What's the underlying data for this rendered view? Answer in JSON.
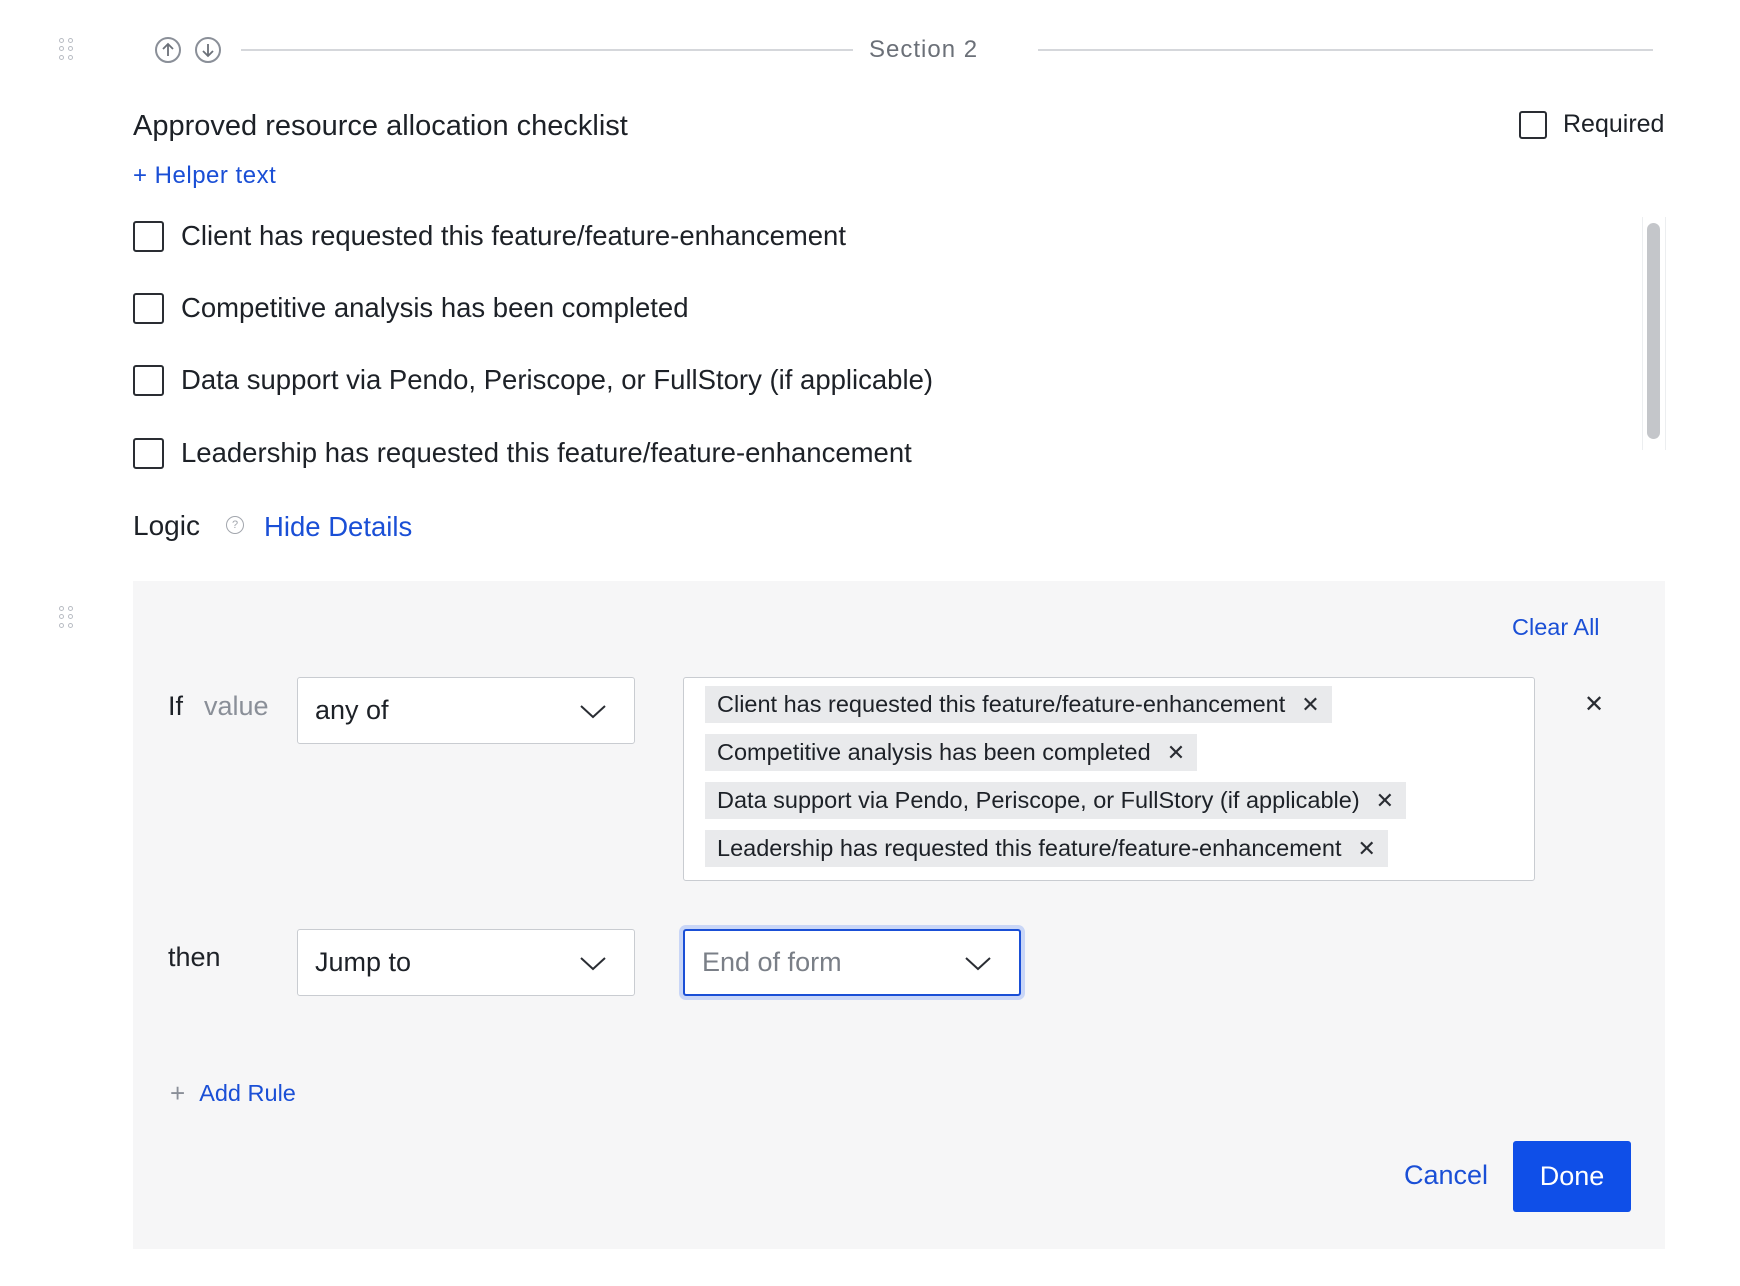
{
  "section": {
    "title": "Section 2",
    "move_up_icon": "arrow-up-circle-icon",
    "move_down_icon": "arrow-down-circle-icon"
  },
  "question": {
    "title": "Approved resource allocation checklist",
    "required_label": "Required",
    "helper_text_link": "+ Helper text",
    "options": [
      "Client has requested this feature/feature-enhancement",
      "Competitive analysis has been completed",
      "Data support via Pendo, Periscope, or FullStory (if applicable)",
      "Leadership has requested this feature/feature-enhancement"
    ]
  },
  "logic": {
    "label": "Logic",
    "help_icon": "question-circle-icon",
    "toggle_link": "Hide Details",
    "clear_all": "Clear All",
    "rule": {
      "if_label": "If",
      "value_label": "value",
      "operator": "any of",
      "selected_values": [
        "Client has requested this feature/feature-enhancement",
        "Competitive analysis has been completed",
        "Data support via Pendo, Periscope, or FullStory (if applicable)",
        "Leadership has requested this feature/feature-enhancement"
      ],
      "then_label": "then",
      "action": "Jump to",
      "target_placeholder": "End of form"
    },
    "add_rule": "Add Rule",
    "cancel": "Cancel",
    "done": "Done"
  },
  "colors": {
    "accent": "#1a4fd6",
    "primary_button": "#0f4fe8",
    "panel_bg": "#f6f6f7"
  }
}
